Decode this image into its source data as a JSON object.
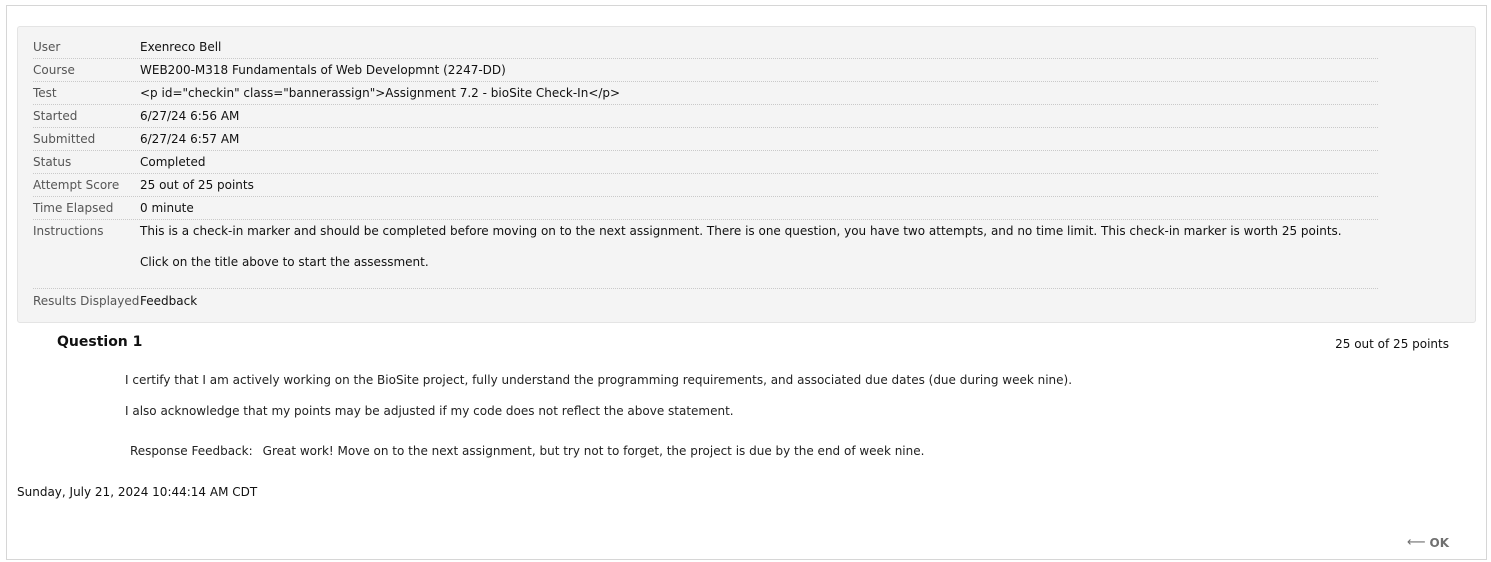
{
  "summary": {
    "user_label": "User",
    "user_value": "Exenreco Bell",
    "course_label": "Course",
    "course_value": "WEB200-M318 Fundamentals of Web Developmnt (2247-DD)",
    "test_label": "Test",
    "test_value": "<p id=\"checkin\" class=\"bannerassign\">Assignment 7.2 - bioSite Check-In</p>",
    "started_label": "Started",
    "started_value": "6/27/24 6:56 AM",
    "submitted_label": "Submitted",
    "submitted_value": "6/27/24 6:57 AM",
    "status_label": "Status",
    "status_value": "Completed",
    "score_label": "Attempt Score",
    "score_value": "25 out of 25 points",
    "elapsed_label": "Time Elapsed",
    "elapsed_value": "0 minute",
    "instructions_label": "Instructions",
    "instructions_line1": "This is a check-in marker and should be completed before moving on to the next assignment.  There is one question, you have two attempts, and no time limit.  This check-in marker is worth 25 points.",
    "instructions_line2": "Click on the title above to start the assessment.",
    "results_label": "Results Displayed",
    "results_value": "Feedback"
  },
  "question": {
    "title": "Question 1",
    "score": "25 out of 25 points",
    "text_line1": "I certify that I am actively working on the BioSite project, fully understand the programming requirements, and associated due dates (due during week nine).",
    "text_line2": "I also acknowledge that my points may be adjusted if my code does not reflect the above statement.",
    "feedback_label": "Response Feedback:",
    "feedback_text": "Great work!  Move on to the next assignment, but try not to forget, the project is due by the end of week nine."
  },
  "footer": {
    "timestamp": "Sunday, July 21, 2024 10:44:14 AM CDT",
    "ok_label": "OK",
    "ok_icon": "left-arrow-icon"
  },
  "colors": {
    "summary_background": "#f4f4f4",
    "ok_text": "#707070"
  }
}
